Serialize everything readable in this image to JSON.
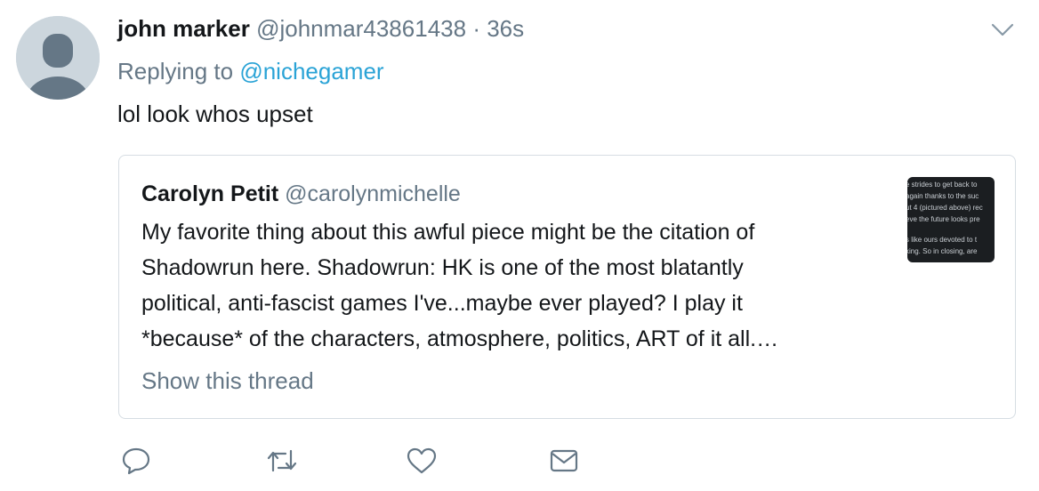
{
  "tweet": {
    "author_name": "john marker",
    "author_handle": "@johnmar43861438",
    "separator": "·",
    "timestamp": "36s",
    "replying_prefix": "Replying to",
    "replying_to": "@nichegamer",
    "text": "lol look whos upset"
  },
  "quoted_tweet": {
    "author_name": "Carolyn Petit",
    "author_handle": "@carolynmichelle",
    "text_lines": [
      "My favorite thing about this awful piece might be the citation of",
      "Shadowrun here. Shadowrun: HK is one of the most blatantly",
      "political, anti-fascist games I've...maybe ever played? I play it",
      "*because* of the characters, atmosphere, politics, ART of it all.…"
    ],
    "show_thread": "Show this thread",
    "thumbnail_lines": [
      "e strides to get back to",
      "again thanks to the suc",
      "ut 4 (pictured above) rec",
      "eve the future looks pre",
      "s like ours devoted to t",
      "king. So in closing, are"
    ]
  },
  "actions": {
    "reply_icon": "reply-icon",
    "retweet_icon": "retweet-icon",
    "like_icon": "heart-icon",
    "dm_icon": "envelope-icon"
  },
  "colors": {
    "handle_gray": "#657786",
    "mention_blue": "#2aa3d6",
    "border": "#d6dde3",
    "avatar_bg": "#ccd6dd"
  }
}
